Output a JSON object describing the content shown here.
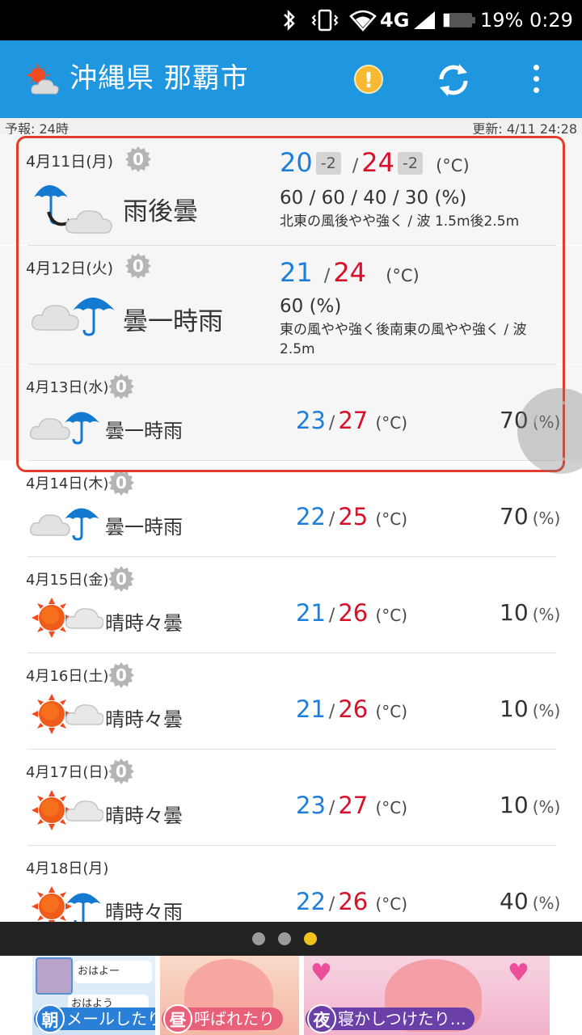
{
  "status_bar": {
    "battery_percent": "19%",
    "time": "0:29",
    "network": "4G"
  },
  "app_bar": {
    "title": "沖縄県 那覇市",
    "alert_glyph": "!"
  },
  "info_bar": {
    "forecast_label": "予報: 24時",
    "updated_label": "更新: 4/11 24:28"
  },
  "days": [
    {
      "date": "4月11日(月)",
      "gear": "0",
      "condition": "雨後曇",
      "min": "20",
      "max": "24",
      "min_diff": "-2",
      "max_diff": "-2",
      "unit": "(°C)",
      "precip": "60 / 60 / 40 / 30 (%)",
      "wind": "北東の風後やや強く / 波 1.5m後2.5m"
    },
    {
      "date": "4月12日(火)",
      "gear": "0",
      "condition": "曇一時雨",
      "min": "21",
      "max": "24",
      "unit": "(°C)",
      "precip": "60 (%)",
      "wind_line1": "東の風やや強く後南東の風やや強く / 波",
      "wind_line2": "2.5m"
    },
    {
      "date": "4月13日(水)",
      "gear": "0",
      "condition": "曇一時雨",
      "min": "23",
      "max": "27",
      "unit": "(°C)",
      "pct": "70",
      "pct_unit": "(%)"
    },
    {
      "date": "4月14日(木)",
      "gear": "0",
      "condition": "曇一時雨",
      "min": "22",
      "max": "25",
      "unit": "(°C)",
      "pct": "70",
      "pct_unit": "(%)"
    },
    {
      "date": "4月15日(金)",
      "gear": "0",
      "condition": "晴時々曇",
      "min": "21",
      "max": "26",
      "unit": "(°C)",
      "pct": "10",
      "pct_unit": "(%)"
    },
    {
      "date": "4月16日(土)",
      "gear": "0",
      "condition": "晴時々曇",
      "min": "21",
      "max": "26",
      "unit": "(°C)",
      "pct": "10",
      "pct_unit": "(%)"
    },
    {
      "date": "4月17日(日)",
      "gear": "0",
      "condition": "晴時々曇",
      "min": "23",
      "max": "27",
      "unit": "(°C)",
      "pct": "10",
      "pct_unit": "(%)"
    },
    {
      "date": "4月18日(月)",
      "condition": "晴時々雨",
      "min": "22",
      "max": "26",
      "unit": "(°C)",
      "pct": "40",
      "pct_unit": "(%)"
    }
  ],
  "temp_separator": "/",
  "pager": {
    "page_count": 3,
    "active_index": 2
  },
  "banner": {
    "panel1_tag": "朝",
    "panel1_text": "メールしたり",
    "panel1_bubble1": "おはよー",
    "panel1_bubble2": "おはよう",
    "panel2_tag": "昼",
    "panel2_text": "呼ばれたり",
    "panel3_tag": "夜",
    "panel3_text": "寝かしつけたり…"
  },
  "colors": {
    "app_bar": "#1e96e0",
    "temp_min": "#1e7fd8",
    "temp_max": "#d8102a",
    "highlight": "#e43b2a",
    "pager_active": "#f3c21c"
  }
}
